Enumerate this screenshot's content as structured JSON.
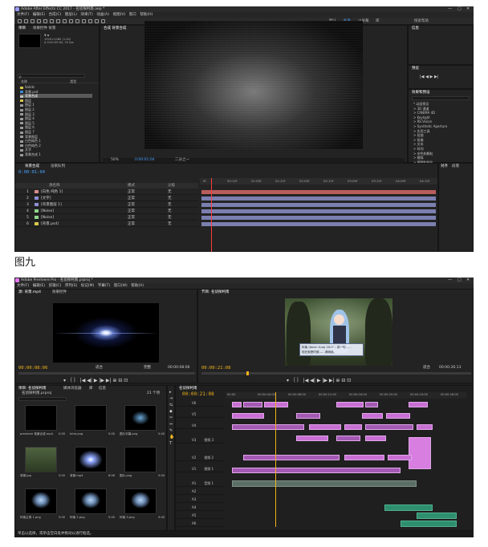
{
  "ae": {
    "title": "Adobe After Effects CC 2017 - 名侦探柯南.aep *",
    "menu": [
      "文件(F)",
      "编辑(E)",
      "合成(C)",
      "图层(L)",
      "效果(T)",
      "动画(A)",
      "视图(V)",
      "窗口",
      "帮助(H)"
    ],
    "window_controls": [
      "—",
      "□",
      "✕"
    ],
    "workspaces": [
      "默认",
      "标准",
      "小屏幕",
      "库"
    ],
    "active_workspace": "标准",
    "search_label": "搜索帮助",
    "project_tab": "项目",
    "effects_tab": "效果控件 背景",
    "comp_tab": "合成 背景合成",
    "project_search": "ρ",
    "project_head_name": "名称",
    "project_head_type": "类型",
    "project_items": [
      {
        "name": "Solids",
        "color": "#d6c74a",
        "selected": false
      },
      {
        "name": "背景.psd",
        "color": "#3d8bd4",
        "selected": false
      },
      {
        "name": "背景合成",
        "color": "#c0c0c0",
        "selected": true
      },
      {
        "name": "图层",
        "color": "#d6c74a",
        "selected": false
      },
      {
        "name": "图层 1",
        "color": "#9a9a9a",
        "selected": false
      },
      {
        "name": "图层 2",
        "color": "#9a9a9a",
        "selected": false
      },
      {
        "name": "图层 3",
        "color": "#9a9a9a",
        "selected": false
      },
      {
        "name": "图层 4",
        "color": "#9a9a9a",
        "selected": false
      },
      {
        "name": "图层 5",
        "color": "#9a9a9a",
        "selected": false
      },
      {
        "name": "图层 6",
        "color": "#9a9a9a",
        "selected": false
      },
      {
        "name": "图层 7",
        "color": "#9a9a9a",
        "selected": false
      },
      {
        "name": "背景图层",
        "color": "#9a9a9a",
        "selected": false
      },
      {
        "name": "白色纯色 1",
        "color": "#9a9a9a",
        "selected": false
      },
      {
        "name": "白色纯色 2",
        "color": "#9a9a9a",
        "selected": false
      },
      {
        "name": "文字",
        "color": "#9a9a9a",
        "selected": false
      },
      {
        "name": "背景合成 1",
        "color": "#9a9a9a",
        "selected": false
      }
    ],
    "viewer_zoom": "50%",
    "viewer_time": "0:00:01:04",
    "viewer_quality": "二分之一",
    "info_tab": "信息",
    "preview_tab": "预览",
    "effects_presets_tab": "效果和预设",
    "effects_list": [
      "* 动画预设",
      "> 3D 通道",
      "> CINEMA 4D",
      "> Keylight",
      "> RE:Vision",
      "> Synthetic Aperture",
      "> 实用工具",
      "> 扭曲",
      "> 抠像",
      "> 文本",
      "> 时间",
      "> 杂色和颗粒",
      "> 模拟",
      "> 模糊和锐化",
      "> 生成"
    ],
    "align_tab": "对齐",
    "paragraph_tab": "段落",
    "timeline_tab": "背景合成",
    "render_tab": "渲染队列",
    "timeline_time": "0:00:01:04",
    "timeline_ticks": [
      "0f",
      "00:12f",
      "01:00f",
      "01:12f",
      "02:00f",
      "02:12f",
      "03:00f",
      "03:12f",
      "04:00f",
      "04:12f"
    ],
    "layers": [
      {
        "index": "1",
        "name": "[白色 纯色 1]",
        "color": "#d98a8a"
      },
      {
        "index": "2",
        "name": "[文字]",
        "color": "#8f8fd6"
      },
      {
        "index": "3",
        "name": "[背景图层 1]",
        "color": "#8f8fd6"
      },
      {
        "index": "4",
        "name": "[Noise]",
        "color": "#8fd68f"
      },
      {
        "index": "5",
        "name": "[Noise]",
        "color": "#8fd68f"
      },
      {
        "index": "6",
        "name": "[背景.psd]",
        "color": "#d6c74a"
      }
    ],
    "col_source": "源名称",
    "col_mode": "模式",
    "col_parent": "父级",
    "mode_value": "正常",
    "parent_value": "无"
  },
  "caption": "图九",
  "pr": {
    "title": "Adobe Premiere Pro - 名侦探柯南.prproj *",
    "menu": [
      "文件(F)",
      "编辑(E)",
      "剪辑(C)",
      "序列(S)",
      "标记(M)",
      "字幕(T)",
      "窗口(W)",
      "帮助(H)"
    ],
    "window_controls": [
      "—",
      "□",
      "✕"
    ],
    "source_tab": "源: 背景.mp4",
    "effects_tab": "效果控件",
    "program_tab": "节目: 名侦探柯南",
    "source_tc": "00:00:08:06",
    "source_dur": "00:00:08:06",
    "program_tc": "00:00:21:08",
    "program_dur": "00:00:26:13",
    "fit_label": "适合",
    "full_label": "完整",
    "dialog_line1": "柯南 (Kevin Guo) 2017 – 说一句……",
    "dialog_line2": "现在就是时候……请继续。",
    "project_tab": "项目: 名侦探柯南",
    "media_tab": "媒体浏览器",
    "library_tab": "库",
    "info_tab": "信息",
    "project_file": "名侦探柯南.prproj",
    "item_count": "21 个项",
    "bin_items": [
      {
        "name": "premiere 背景合成.mp4",
        "dur": "0:00"
      },
      {
        "name": "Intro.png",
        "dur": "5:00"
      },
      {
        "name": "图片字幕.png",
        "dur": "5:00"
      },
      {
        "name": "背景.jpg",
        "dur": "5:00"
      },
      {
        "name": "背景.mp4",
        "dur": "8:06"
      },
      {
        "name": "图片.png",
        "dur": "5:00"
      },
      {
        "name": "柯南主角 1.png",
        "dur": "5:00"
      },
      {
        "name": "柯南 2.png",
        "dur": "5:00"
      },
      {
        "name": "柯南 3.png",
        "dur": "5:00"
      }
    ],
    "sequence_tab": "名侦探柯南",
    "timeline_tc": "00:00:21:08",
    "timeline_ticks": [
      "00:00",
      "00:00:04:00",
      "00:00:08:00",
      "00:00:12:00",
      "00:00:16:00",
      "00:00:20:00",
      "00:00:24:00",
      "00:00:28:00"
    ],
    "video_tracks": [
      "V6",
      "V5",
      "V4",
      "V3",
      "V2",
      "V1"
    ],
    "audio_tracks": [
      "A1",
      "A2",
      "A3",
      "A4",
      "A5",
      "A6"
    ],
    "video_track_names": [
      "",
      "",
      "",
      "视频 3",
      "视频 2",
      "视频 1"
    ],
    "audio_track_names": [
      "音频 1",
      "",
      "",
      "",
      "",
      ""
    ],
    "status": "单击以选择，或单击空白处并拖动以进行框选。"
  },
  "colors": {
    "ae_accent": "#9999ff",
    "pr_accent": "#ea77ff",
    "timecode": "#f0b21a",
    "video_clip": "#c86fd4",
    "audio_clip": "#2e8f6e",
    "playhead": "#ff3b3b"
  }
}
